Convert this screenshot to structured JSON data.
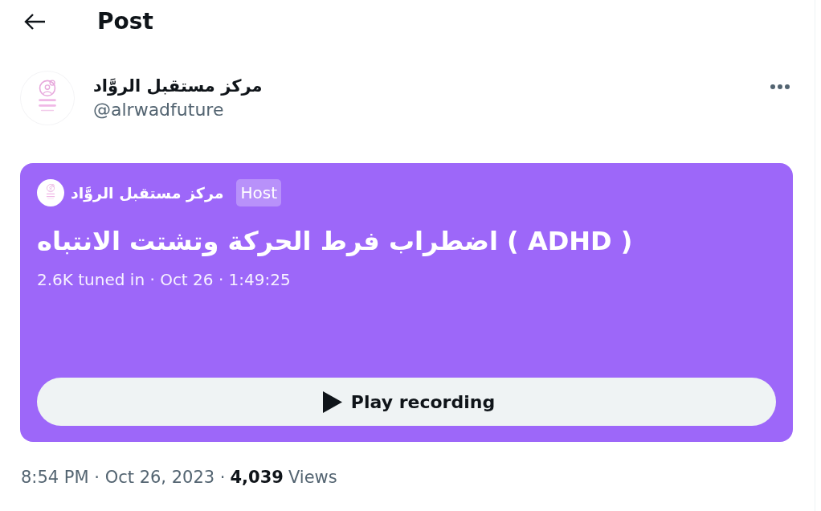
{
  "header": {
    "title": "Post"
  },
  "author": {
    "name": "مركز مستقبل الروَّاد",
    "handle": "@alrwadfuture"
  },
  "space_card": {
    "host": {
      "name": "مركز مستقبل الروَّاد",
      "badge": "Host"
    },
    "title": "اضطراب فرط الحركة وتشتت الانتباه ( ADHD )",
    "meta": "2.6K tuned in · Oct 26 · 1:49:25",
    "play_button": "Play recording"
  },
  "footer": {
    "timestamp": "8:54 PM · Oct 26, 2023 ·",
    "views_count": "4,039",
    "views_label": "Views"
  }
}
